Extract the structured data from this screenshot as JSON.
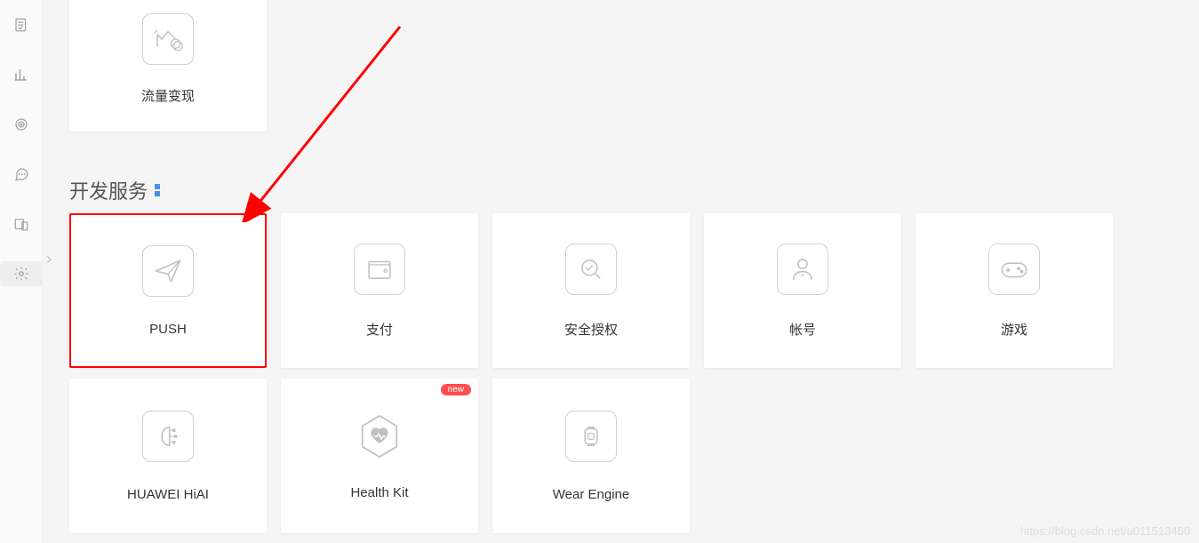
{
  "sidebar": {
    "items": [
      {
        "name": "document-check-icon"
      },
      {
        "name": "bar-chart-icon"
      },
      {
        "name": "target-icon"
      },
      {
        "name": "chat-icon"
      },
      {
        "name": "device-icon"
      },
      {
        "name": "settings-icon"
      }
    ]
  },
  "top_card": {
    "label": "流量变现"
  },
  "section": {
    "title": "开发服务"
  },
  "cards_row1": [
    {
      "label": "PUSH",
      "icon": "paper-plane",
      "highlighted": true
    },
    {
      "label": "支付",
      "icon": "wallet"
    },
    {
      "label": "安全授权",
      "icon": "shield-check"
    },
    {
      "label": "帐号",
      "icon": "user"
    },
    {
      "label": "游戏",
      "icon": "gamepad"
    }
  ],
  "cards_row2": [
    {
      "label": "HUAWEI HiAI",
      "icon": "brain-chip"
    },
    {
      "label": "Health Kit",
      "icon": "heart-rate",
      "badge": "new"
    },
    {
      "label": "Wear Engine",
      "icon": "watch"
    }
  ],
  "watermark": "https://blog.csdn.net/u011513460",
  "annotation": {
    "arrow_color": "#ff0000"
  }
}
